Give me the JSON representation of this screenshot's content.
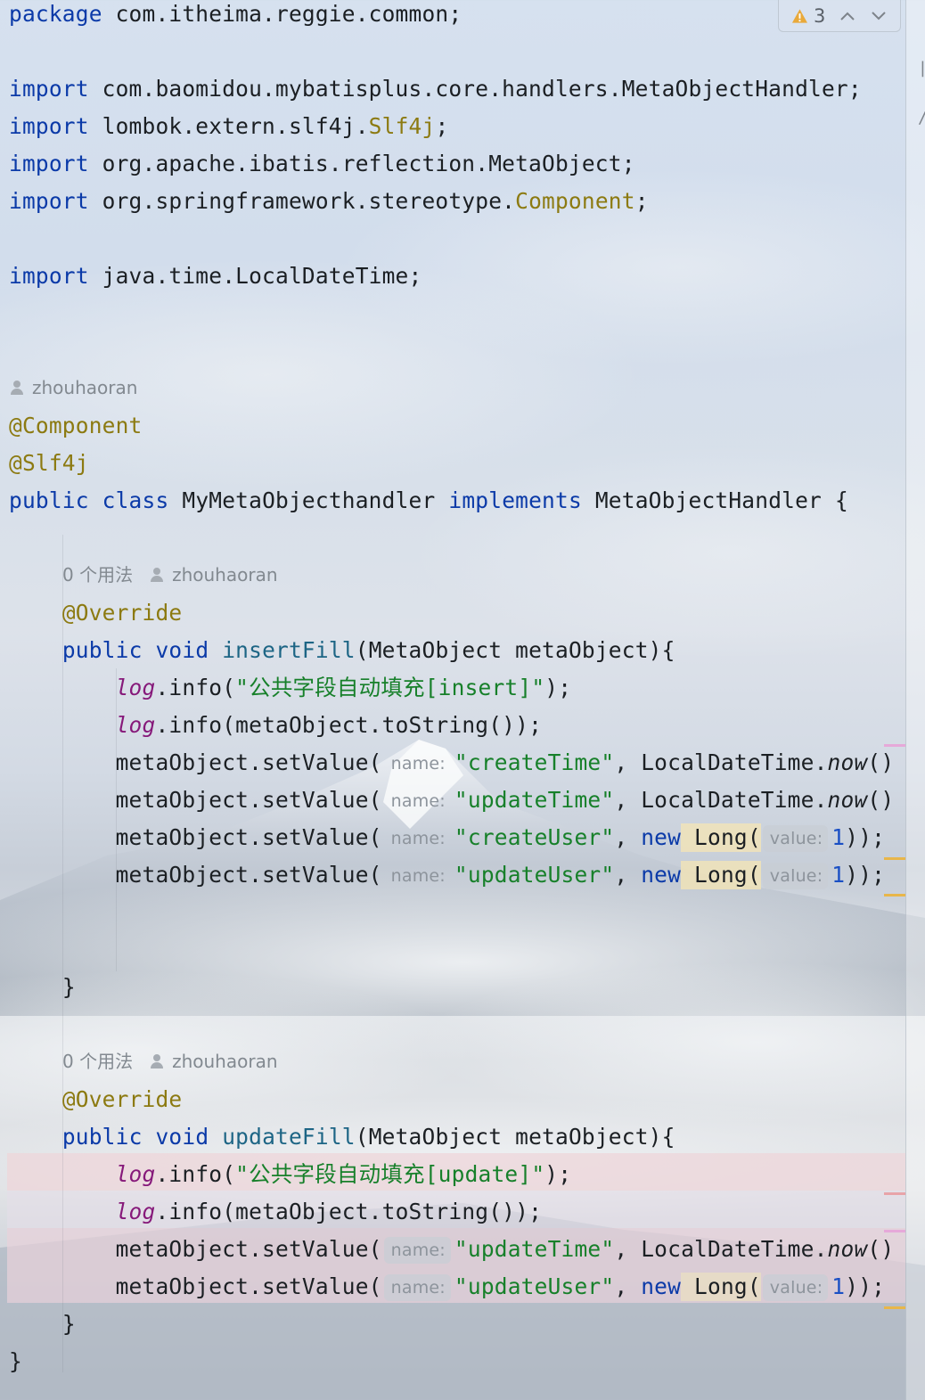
{
  "inspection": {
    "warning_count": "3",
    "warning_icon": "warning-triangle-icon",
    "prev_icon": "chevron-up-icon",
    "next_icon": "chevron-down-icon",
    "warning_color": "#e9a93a"
  },
  "code": {
    "package_kw": "package",
    "package_name": " com.itheima.reggie.common;",
    "import_kw": "import",
    "imports": [
      " com.baomidou.mybatisplus.core.handlers.MetaObjectHandler;",
      " lombok.extern.slf4j.",
      " org.apache.ibatis.reflection.MetaObject;",
      " org.springframework.stereotype.",
      " java.time.LocalDateTime;"
    ],
    "import_tails": {
      "slf4j_class": "Slf4j",
      "component_class": "Component",
      "semicolon": ";"
    },
    "class_author": "zhouhaoran",
    "annotations": [
      "@Component",
      "@Slf4j"
    ],
    "class_decl": {
      "public_kw": "public",
      "class_kw": "class",
      "class_name": " MyMetaObjecthandler ",
      "implements_kw": "implements",
      "interface_name": " MetaObjectHandler {"
    },
    "methods": [
      {
        "usage": "0 个用法",
        "author": "zhouhaoran",
        "override": "@Override",
        "public_kw": "public",
        "void_kw": "void",
        "name": "insertFill",
        "params": "(MetaObject metaObject){",
        "log_info_str": "\"公共字段自动填充[insert]\"",
        "log_tostring": ".info(metaObject.toString());",
        "set_values": [
          {
            "field": "\"createTime\"",
            "kind": "now"
          },
          {
            "field": "\"updateTime\"",
            "kind": "now"
          },
          {
            "field": "\"createUser\"",
            "kind": "long"
          },
          {
            "field": "\"updateUser\"",
            "kind": "long"
          }
        ],
        "close": "}"
      },
      {
        "usage": "0 个用法",
        "author": "zhouhaoran",
        "override": "@Override",
        "public_kw": "public",
        "void_kw": "void",
        "name": "updateFill",
        "params": "(MetaObject metaObject){",
        "log_info_str": "\"公共字段自动填充[update]\"",
        "log_tostring": ".info(metaObject.toString());",
        "set_values": [
          {
            "field": "\"updateTime\"",
            "kind": "now"
          },
          {
            "field": "\"updateUser\"",
            "kind": "long"
          }
        ],
        "close": "}"
      }
    ],
    "tokens": {
      "log": "log",
      "info_open": ".info(",
      "info_close": ");",
      "set_value_call": "metaObject.setValue(",
      "name_hint": "name:",
      "value_hint": "value:",
      "comma_space": ", ",
      "localdatetime": "LocalDateTime.",
      "now": "now",
      "now_tail": "()",
      "new_kw": "new",
      "long_open": " Long(",
      "long_value": "1",
      "long_close": "));"
    },
    "class_close": "}"
  },
  "colors": {
    "keyword": "#0b3aa8",
    "annotation": "#8c7a11",
    "string": "#17802a",
    "log_field": "#86197a",
    "changed_line_bg": "#eed9dc"
  }
}
